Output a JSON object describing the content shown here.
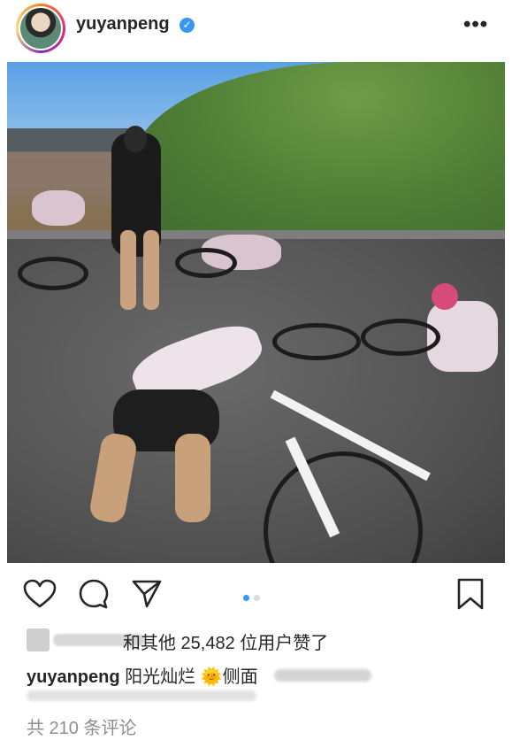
{
  "post": {
    "username": "yuyanpeng",
    "verified_icon": "verified-badge-icon",
    "more_icon": "more-options-icon",
    "more_glyph": "•••",
    "photo_alt": "cyclists resting on road",
    "carousel": {
      "total": 2,
      "active": 1,
      "active_color": "#3897f0",
      "inactive_color": "#dbdbdb"
    },
    "actions": [
      "heart-icon",
      "comment-icon",
      "share-icon",
      "bookmark-icon"
    ],
    "likes_text": "和其他 25,482 位用户赞了",
    "caption_user": "yuyanpeng",
    "caption_text": "阳光灿烂",
    "caption_emoji": "🌞",
    "caption_after": "侧面",
    "comments_text": "共 210 条评论"
  }
}
